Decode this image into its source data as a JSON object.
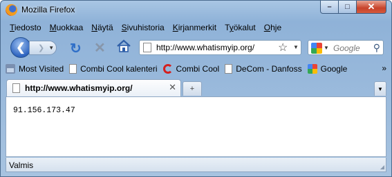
{
  "window": {
    "title": "Mozilla Firefox"
  },
  "window_buttons": {
    "minimize": "–",
    "maximize": "□",
    "close": "✕"
  },
  "menu": [
    {
      "label": "Tiedosto",
      "u": "T",
      "rest": "iedosto"
    },
    {
      "label": "Muokkaa",
      "u": "M",
      "rest": "uokkaa"
    },
    {
      "label": "Näytä",
      "u": "N",
      "rest": "äytä"
    },
    {
      "label": "Sivuhistoria",
      "u": "S",
      "rest": "ivuhistoria"
    },
    {
      "label": "Kirjanmerkit",
      "u": "K",
      "rest": "irjanmerkit"
    },
    {
      "label": "Työkalut",
      "pre": "T",
      "u": "y",
      "rest": "ökalut"
    },
    {
      "label": "Ohje",
      "u": "O",
      "rest": "hje"
    }
  ],
  "navbar": {
    "url": "http://www.whatismyip.org/",
    "search_placeholder": "Google",
    "icons": [
      "back-icon",
      "forward-icon",
      "reload-icon",
      "stop-icon",
      "home-icon",
      "star-icon",
      "search-icon"
    ]
  },
  "bookmarks": {
    "items": [
      {
        "label": "Most Visited",
        "icon": "most-visited-icon"
      },
      {
        "label": "Combi Cool kalenteri",
        "icon": "page-icon"
      },
      {
        "label": "Combi Cool",
        "icon": "c-logo-icon"
      },
      {
        "label": "DeCom - Danfoss",
        "icon": "page-icon"
      },
      {
        "label": "Google",
        "icon": "google-icon"
      }
    ],
    "more": "»"
  },
  "tabs": [
    {
      "label": "http://www.whatismyip.org/"
    }
  ],
  "content": {
    "ip": "91.156.173.47"
  },
  "status": {
    "text": "Valmis"
  }
}
